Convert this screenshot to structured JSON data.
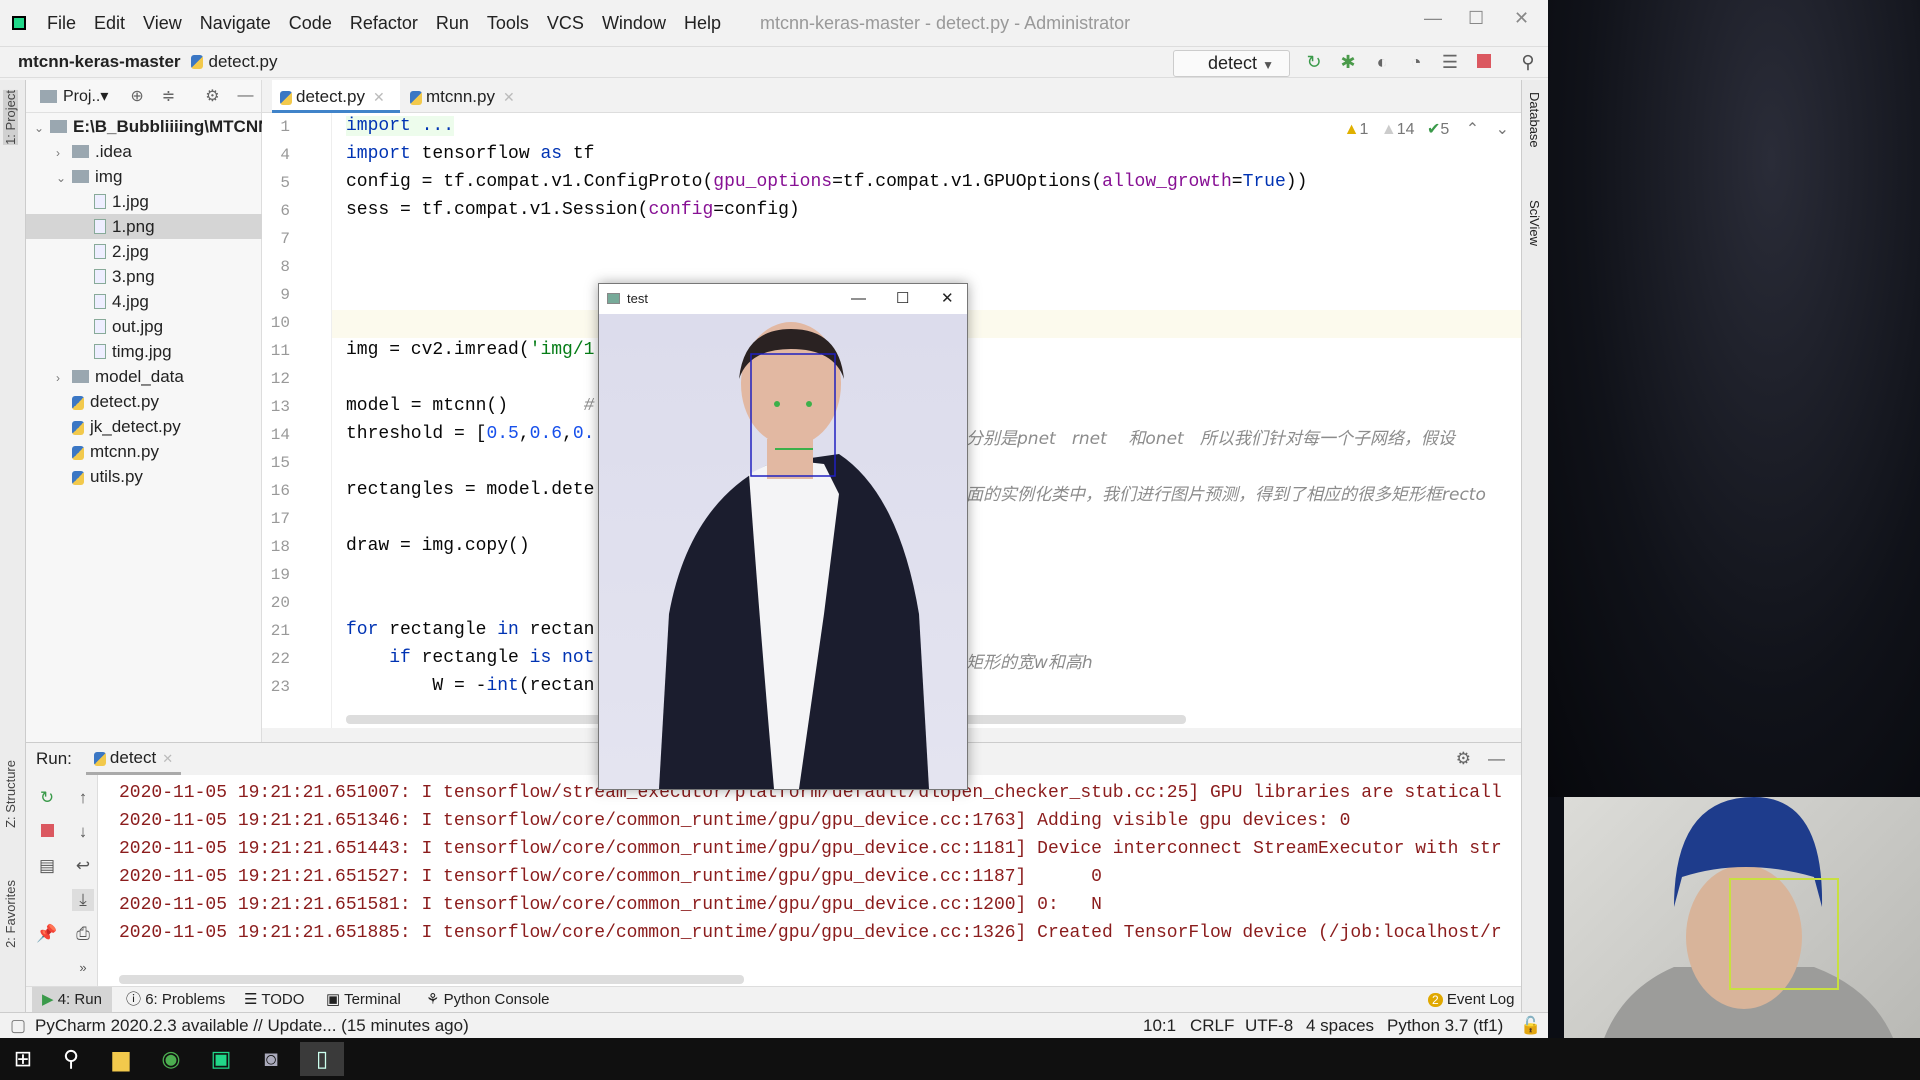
{
  "menu": [
    "File",
    "Edit",
    "View",
    "Navigate",
    "Code",
    "Refactor",
    "Run",
    "Tools",
    "VCS",
    "Window",
    "Help"
  ],
  "window_title": "mtcnn-keras-master - detect.py - Administrator",
  "breadcrumb": {
    "project": "mtcnn-keras-master",
    "file": "detect.py"
  },
  "run_config": "detect",
  "project_panel": {
    "title": "Proj..▾",
    "tree": [
      {
        "label": "E:\\B_Bubbliiiing\\MTCNN",
        "type": "folder",
        "depth": 0,
        "expanded": true
      },
      {
        "label": ".idea",
        "type": "folder",
        "depth": 1,
        "expanded": false
      },
      {
        "label": "img",
        "type": "folder",
        "depth": 1,
        "expanded": true
      },
      {
        "label": "1.jpg",
        "type": "file",
        "depth": 2
      },
      {
        "label": "1.png",
        "type": "file",
        "depth": 2,
        "selected": true
      },
      {
        "label": "2.jpg",
        "type": "file",
        "depth": 2
      },
      {
        "label": "3.png",
        "type": "file",
        "depth": 2
      },
      {
        "label": "4.jpg",
        "type": "file",
        "depth": 2
      },
      {
        "label": "out.jpg",
        "type": "file",
        "depth": 2
      },
      {
        "label": "timg.jpg",
        "type": "file",
        "depth": 2
      },
      {
        "label": "model_data",
        "type": "folder",
        "depth": 1,
        "expanded": false
      },
      {
        "label": "detect.py",
        "type": "py",
        "depth": 1
      },
      {
        "label": "jk_detect.py",
        "type": "py",
        "depth": 1
      },
      {
        "label": "mtcnn.py",
        "type": "py",
        "depth": 1
      },
      {
        "label": "utils.py",
        "type": "py",
        "depth": 1
      }
    ]
  },
  "tabs": [
    {
      "label": "detect.py",
      "active": true
    },
    {
      "label": "mtcnn.py",
      "active": false
    }
  ],
  "inspections": {
    "warnings": "1",
    "weak_warnings": "14",
    "typos": "5"
  },
  "code": [
    {
      "n": "1",
      "t": [
        [
          "import ...",
          "kw"
        ]
      ]
    },
    {
      "n": "4",
      "t": [
        [
          "import",
          "kw"
        ],
        [
          " tensorflow ",
          ""
        ],
        [
          "as",
          "kw"
        ],
        [
          " tf",
          ""
        ]
      ]
    },
    {
      "n": "5",
      "t": [
        [
          "config = tf.compat.v1.ConfigProto(",
          ""
        ],
        [
          "gpu_options",
          "pm"
        ],
        [
          "=tf.compat.v1.GPUOptions(",
          ""
        ],
        [
          "allow_growth",
          "pm"
        ],
        [
          "=",
          ""
        ],
        [
          "True",
          "kw"
        ],
        [
          "))",
          ""
        ]
      ]
    },
    {
      "n": "6",
      "t": [
        [
          "sess = tf.compat.v1.Session(",
          ""
        ],
        [
          "config",
          "pm"
        ],
        [
          "=config)",
          ""
        ]
      ]
    },
    {
      "n": "7",
      "t": []
    },
    {
      "n": "8",
      "t": []
    },
    {
      "n": "9",
      "t": []
    },
    {
      "n": "10",
      "t": []
    },
    {
      "n": "11",
      "t": [
        [
          "img = cv2.imread(",
          ""
        ],
        [
          "'img/1",
          "str"
        ]
      ]
    },
    {
      "n": "12",
      "t": []
    },
    {
      "n": "13",
      "t": [
        [
          "model = mtcnn()       ",
          ""
        ],
        [
          "#",
          "cm"
        ]
      ]
    },
    {
      "n": "14",
      "t": [
        [
          "threshold = [",
          ""
        ],
        [
          "0.5",
          "num"
        ],
        [
          ",",
          ""
        ],
        [
          "0.6",
          "num"
        ],
        [
          ",",
          ""
        ],
        [
          "0.",
          "num"
        ]
      ]
    },
    {
      "n": "15",
      "t": []
    },
    {
      "n": "16",
      "t": [
        [
          "rectangles = model.dete",
          ""
        ]
      ]
    },
    {
      "n": "17",
      "t": []
    },
    {
      "n": "18",
      "t": [
        [
          "draw = img.copy()",
          ""
        ]
      ]
    },
    {
      "n": "19",
      "t": []
    },
    {
      "n": "20",
      "t": []
    },
    {
      "n": "21",
      "t": [
        [
          "for",
          "kw"
        ],
        [
          " rectangle ",
          ""
        ],
        [
          "in",
          "kw"
        ],
        [
          " rectan",
          ""
        ]
      ]
    },
    {
      "n": "22",
      "t": [
        [
          "    ",
          ""
        ],
        [
          "if",
          "kw"
        ],
        [
          " rectangle ",
          ""
        ],
        [
          "is not",
          "kw"
        ]
      ]
    },
    {
      "n": "23",
      "t": [
        [
          "        W = -",
          ""
        ],
        [
          "int",
          "kw"
        ],
        [
          "(rectan",
          ""
        ]
      ]
    }
  ],
  "comments": {
    "line14": "分别是pnet   rnet    和onet   所以我们针对每一个子网络，假设",
    "line16": "面的实例化类中，我们进行图片预测，得到了相应的很多矩形框recto",
    "line22": "矩形的宽w和高h"
  },
  "run_panel": {
    "label": "Run:",
    "tab": "detect",
    "lines": [
      "2020-11-05 19:21:21.651007: I tensorflow/stream_executor/platform/default/dlopen_checker_stub.cc:25] GPU libraries are staticall",
      "2020-11-05 19:21:21.651346: I tensorflow/core/common_runtime/gpu/gpu_device.cc:1763] Adding visible gpu devices: 0",
      "2020-11-05 19:21:21.651443: I tensorflow/core/common_runtime/gpu/gpu_device.cc:1181] Device interconnect StreamExecutor with str",
      "2020-11-05 19:21:21.651527: I tensorflow/core/common_runtime/gpu/gpu_device.cc:1187]      0",
      "2020-11-05 19:21:21.651581: I tensorflow/core/common_runtime/gpu/gpu_device.cc:1200] 0:   N",
      "2020-11-05 19:21:21.651885: I tensorflow/core/common_runtime/gpu/gpu_device.cc:1326] Created TensorFlow device (/job:localhost/r"
    ]
  },
  "tool_windows": [
    "4: Run",
    "6: Problems",
    "TODO",
    "Terminal",
    "Python Console"
  ],
  "event_log": {
    "count": "2",
    "label": "Event Log"
  },
  "side_labels": {
    "project": "1: Project",
    "structure": "Z: Structure",
    "favorites": "2: Favorites",
    "database": "Database",
    "sciview": "SciView"
  },
  "status": {
    "message": "PyCharm 2020.2.3 available // Update... (15 minutes ago)",
    "position": "10:1",
    "line_sep": "CRLF",
    "encoding": "UTF-8",
    "indent": "4 spaces",
    "interpreter": "Python 3.7 (tf1)"
  },
  "test_window": {
    "title": "test"
  },
  "colors": {
    "accent": "#4083c9",
    "console_text": "#8b1c1c",
    "keyword": "#0033b3",
    "face_box": "#2020c0",
    "webcam_box": "#c8e040"
  }
}
